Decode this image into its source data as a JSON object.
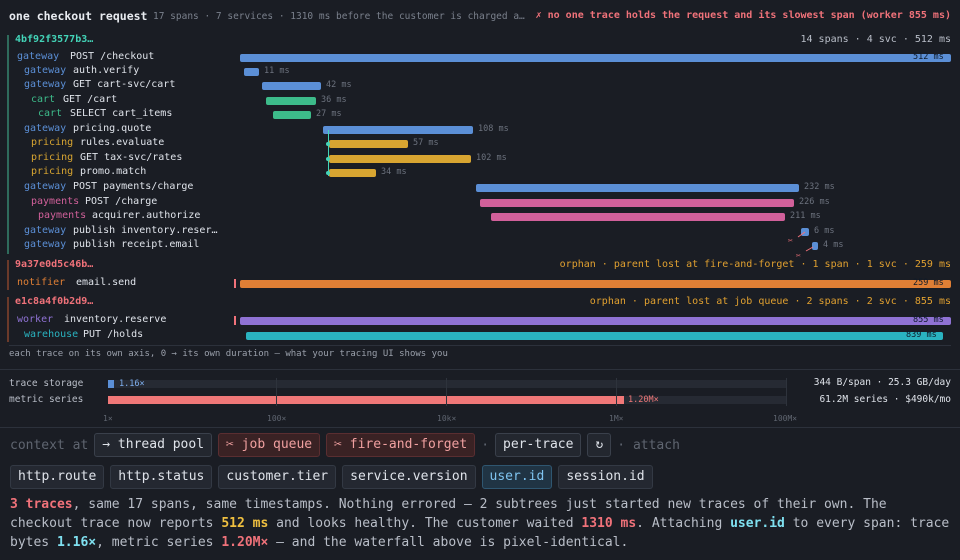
{
  "header": {
    "title": "one checkout request",
    "subtitle": "17 spans · 7 services · 1310 ms before the customer is charged a…",
    "alert": "✗ no one trace holds the request and its slowest span (worker 855 ms)"
  },
  "colors": {
    "gateway": "#5b8fd6",
    "cart": "#3dbb8a",
    "pricing": "#d8a531",
    "payments": "#d1609a",
    "notifier": "#e07f35",
    "worker": "#8f72d4",
    "warehouse": "#2ab3c0"
  },
  "traces": [
    {
      "id": "4bf92f3577b3…",
      "meta": "14 spans  ·  4 svc  ·  512 ms",
      "spans": [
        {
          "svc": "gateway",
          "op": "POST /checkout",
          "dur": "512 ms"
        },
        {
          "svc": "gateway",
          "op": "auth.verify",
          "dur": "11 ms"
        },
        {
          "svc": "gateway",
          "op": "GET cart-svc/cart",
          "dur": "42 ms"
        },
        {
          "svc": "cart",
          "op": "GET /cart",
          "dur": "36 ms"
        },
        {
          "svc": "cart",
          "op": "SELECT cart_items",
          "dur": "27 ms"
        },
        {
          "svc": "gateway",
          "op": "pricing.quote",
          "dur": "108 ms"
        },
        {
          "svc": "pricing",
          "op": "rules.evaluate",
          "dur": "57 ms"
        },
        {
          "svc": "pricing",
          "op": "GET tax-svc/rates",
          "dur": "102 ms"
        },
        {
          "svc": "pricing",
          "op": "promo.match",
          "dur": "34 ms"
        },
        {
          "svc": "gateway",
          "op": "POST payments/charge",
          "dur": "232 ms"
        },
        {
          "svc": "payments",
          "op": "POST /charge",
          "dur": "226 ms"
        },
        {
          "svc": "payments",
          "op": "acquirer.authorize",
          "dur": "211 ms"
        },
        {
          "svc": "gateway",
          "op": "publish inventory.reser…",
          "dur": "6 ms"
        },
        {
          "svc": "gateway",
          "op": "publish receipt.email",
          "dur": "4 ms"
        }
      ]
    },
    {
      "id": "9a37e0d5c46b…",
      "meta": "orphan · parent lost at fire-and-forget  ·  1 span  ·  1 svc  ·  259 ms",
      "spans": [
        {
          "svc": "notifier",
          "op": "email.send",
          "dur": "259 ms"
        }
      ]
    },
    {
      "id": "e1c8a4f0b2d9…",
      "meta": "orphan · parent lost at job queue  ·  2 spans  ·  2 svc  ·  855 ms",
      "spans": [
        {
          "svc": "worker",
          "op": "inventory.reserve",
          "dur": "855 ms"
        },
        {
          "svc": "warehouse",
          "op": "PUT /holds",
          "dur": "839 ms"
        }
      ]
    }
  ],
  "footnote": "each trace on its own axis, 0 → its own duration — what your tracing UI shows you",
  "meters": {
    "storage": {
      "label": "trace storage",
      "value": "1.16×",
      "right": "344 B/span · 25.3 GB/day",
      "color": "#5b8fd6"
    },
    "series": {
      "label": "metric series",
      "value": "1.20M×",
      "right": "61.2M series · $490k/mo",
      "color": "#f07878"
    },
    "ticks": [
      "1×",
      "100×",
      "10k×",
      "1M×",
      "100M×"
    ]
  },
  "controls": {
    "context_label": "context at",
    "buttons": [
      "→ thread pool",
      "✂ job queue",
      "✂ fire-and-forget"
    ],
    "per_trace": "per-trace",
    "reset_icon": "↻",
    "attach_label": "· attach"
  },
  "attributes": [
    {
      "label": "http.route",
      "active": false
    },
    {
      "label": "http.status",
      "active": false
    },
    {
      "label": "customer.tier",
      "active": false
    },
    {
      "label": "service.version",
      "active": false
    },
    {
      "label": "user.id",
      "active": true
    },
    {
      "label": "session.id",
      "active": false
    }
  ],
  "summary": {
    "traces": "3 traces",
    "t1": ", same 17 spans, same timestamps. Nothing errored — 2 subtrees just started new traces of their own. The checkout trace now reports ",
    "reported": "512 ms",
    "t2": " and looks healthy. The customer waited ",
    "waited": "1310 ms",
    "t3": ". Attaching ",
    "attr": "user.id",
    "t4": " to every span: trace bytes ",
    "bytes": "1.16×",
    "t5": ", metric series ",
    "series": "1.20M×",
    "t6": " — and the waterfall above is pixel-identical."
  }
}
